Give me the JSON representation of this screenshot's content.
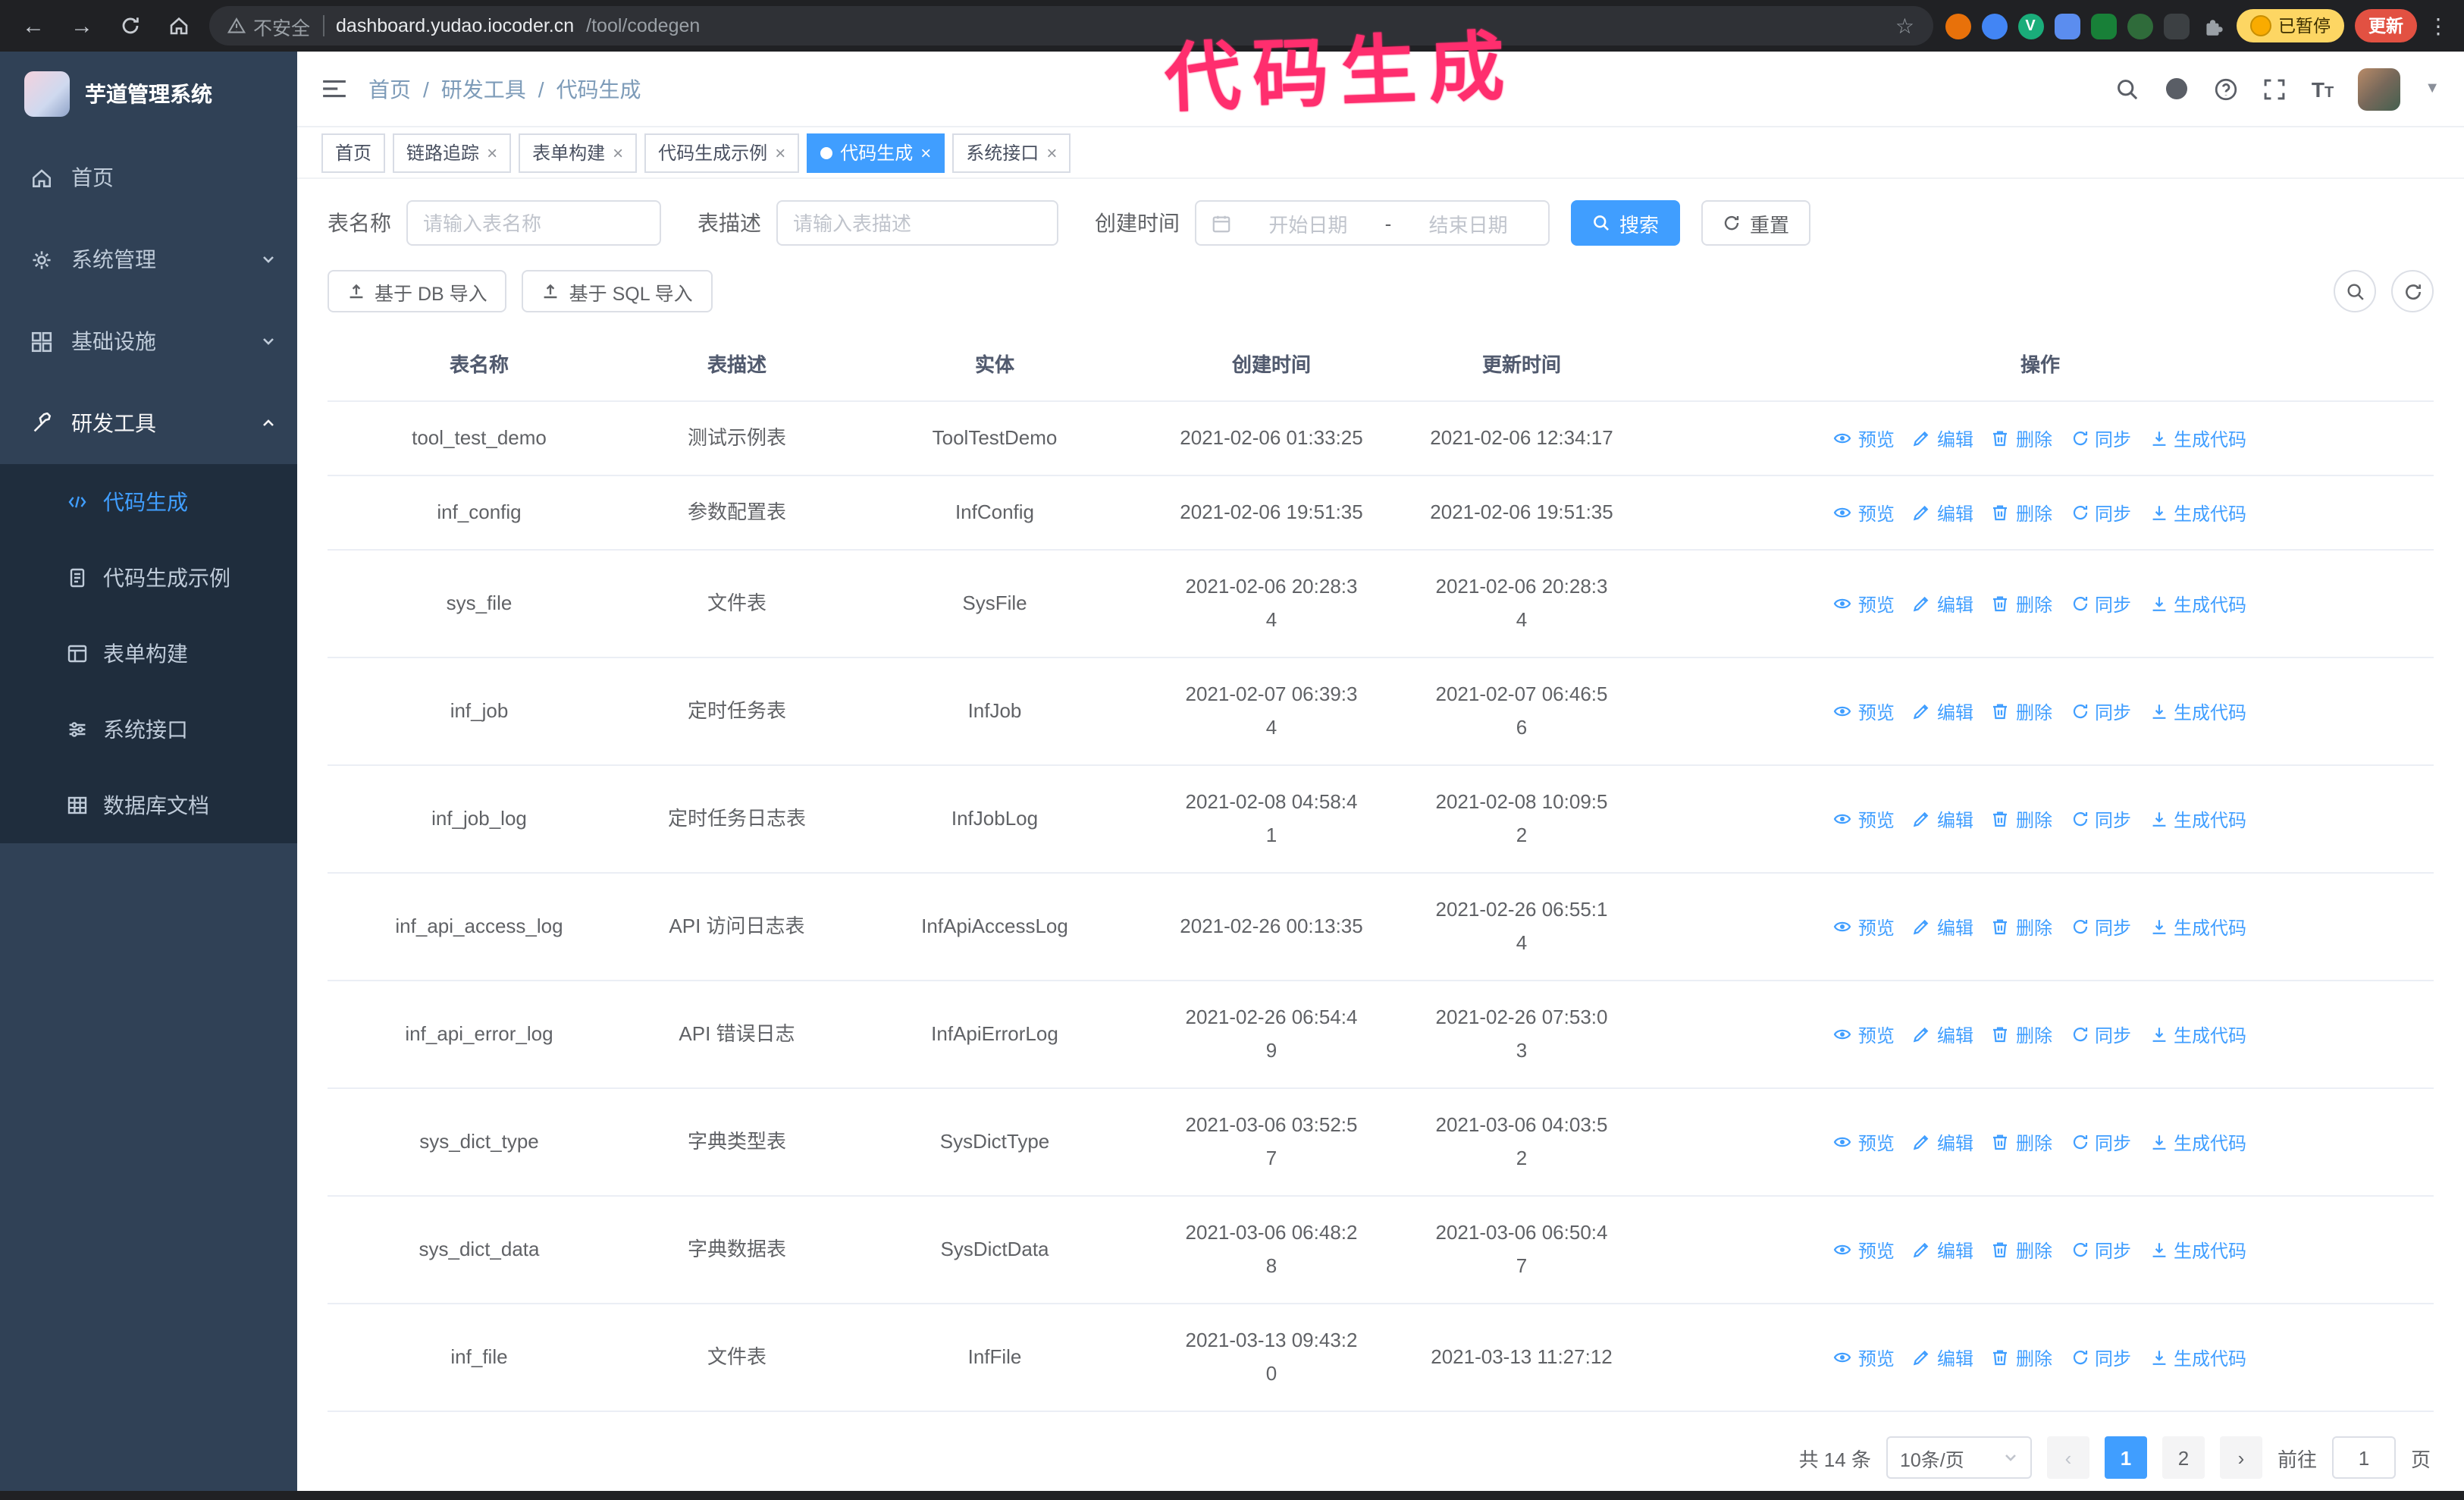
{
  "browser": {
    "security_label": "不安全",
    "url_domain": "dashboard.yudao.iocoder.cn",
    "url_path": "/tool/codegen",
    "extension_v_letter": "V",
    "paused_badge": "已暂停",
    "update_button": "更新"
  },
  "annotation": {
    "text": "代码生成"
  },
  "colors": {
    "accent": "#409eff",
    "annotation_pink": "#ff2e6e",
    "sidebar_bg": "#304156",
    "submenu_bg": "#1f2d3d"
  },
  "sidebar": {
    "logo_title": "芋道管理系统",
    "items": [
      {
        "label": "首页"
      },
      {
        "label": "系统管理"
      },
      {
        "label": "基础设施"
      },
      {
        "label": "研发工具"
      }
    ],
    "sub_items": [
      {
        "label": "代码生成"
      },
      {
        "label": "代码生成示例"
      },
      {
        "label": "表单构建"
      },
      {
        "label": "系统接口"
      },
      {
        "label": "数据库文档"
      }
    ]
  },
  "breadcrumb": [
    "首页",
    "研发工具",
    "代码生成"
  ],
  "tabs": [
    {
      "label": "首页"
    },
    {
      "label": "链路追踪"
    },
    {
      "label": "表单构建"
    },
    {
      "label": "代码生成示例"
    },
    {
      "label": "代码生成"
    },
    {
      "label": "系统接口"
    }
  ],
  "filters": {
    "name_label": "表名称",
    "name_placeholder": "请输入表名称",
    "desc_label": "表描述",
    "desc_placeholder": "请输入表描述",
    "time_label": "创建时间",
    "start_placeholder": "开始日期",
    "range_separator": "-",
    "end_placeholder": "结束日期",
    "search_button": "搜索",
    "reset_button": "重置"
  },
  "toolbar": {
    "import_db": "基于 DB 导入",
    "import_sql": "基于 SQL 导入"
  },
  "table": {
    "columns": [
      "表名称",
      "表描述",
      "实体",
      "创建时间",
      "更新时间",
      "操作"
    ],
    "op_labels": [
      "预览",
      "编辑",
      "删除",
      "同步",
      "生成代码"
    ],
    "rows": [
      {
        "name": "tool_test_demo",
        "desc": "测试示例表",
        "entity": "ToolTestDemo",
        "create_time": "2021-02-06 01:33:25",
        "update_time": "2021-02-06 12:34:17"
      },
      {
        "name": "inf_config",
        "desc": "参数配置表",
        "entity": "InfConfig",
        "create_time": "2021-02-06 19:51:35",
        "update_time": "2021-02-06 19:51:35"
      },
      {
        "name": "sys_file",
        "desc": "文件表",
        "entity": "SysFile",
        "create_time": [
          "2021-02-06 20:28:3",
          "4"
        ],
        "update_time": [
          "2021-02-06 20:28:3",
          "4"
        ]
      },
      {
        "name": "inf_job",
        "desc": "定时任务表",
        "entity": "InfJob",
        "create_time": [
          "2021-02-07 06:39:3",
          "4"
        ],
        "update_time": [
          "2021-02-07 06:46:5",
          "6"
        ]
      },
      {
        "name": "inf_job_log",
        "desc": "定时任务日志表",
        "entity": "InfJobLog",
        "create_time": [
          "2021-02-08 04:58:4",
          "1"
        ],
        "update_time": [
          "2021-02-08 10:09:5",
          "2"
        ]
      },
      {
        "name": "inf_api_access_log",
        "desc": "API 访问日志表",
        "entity": "InfApiAccessLog",
        "create_time": "2021-02-26 00:13:35",
        "update_time": [
          "2021-02-26 06:55:1",
          "4"
        ]
      },
      {
        "name": "inf_api_error_log",
        "desc": "API 错误日志",
        "entity": "InfApiErrorLog",
        "create_time": [
          "2021-02-26 06:54:4",
          "9"
        ],
        "update_time": [
          "2021-02-26 07:53:0",
          "3"
        ]
      },
      {
        "name": "sys_dict_type",
        "desc": "字典类型表",
        "entity": "SysDictType",
        "create_time": [
          "2021-03-06 03:52:5",
          "7"
        ],
        "update_time": [
          "2021-03-06 04:03:5",
          "2"
        ]
      },
      {
        "name": "sys_dict_data",
        "desc": "字典数据表",
        "entity": "SysDictData",
        "create_time": [
          "2021-03-06 06:48:2",
          "8"
        ],
        "update_time": [
          "2021-03-06 06:50:4",
          "7"
        ]
      },
      {
        "name": "inf_file",
        "desc": "文件表",
        "entity": "InfFile",
        "create_time": [
          "2021-03-13 09:43:2",
          "0"
        ],
        "update_time": "2021-03-13 11:27:12"
      }
    ]
  },
  "pagination": {
    "total_text": "共 14 条",
    "page_size_label": "10条/页",
    "pages": [
      "1",
      "2"
    ],
    "goto_label": "前往",
    "goto_value": "1",
    "goto_suffix": "页"
  }
}
